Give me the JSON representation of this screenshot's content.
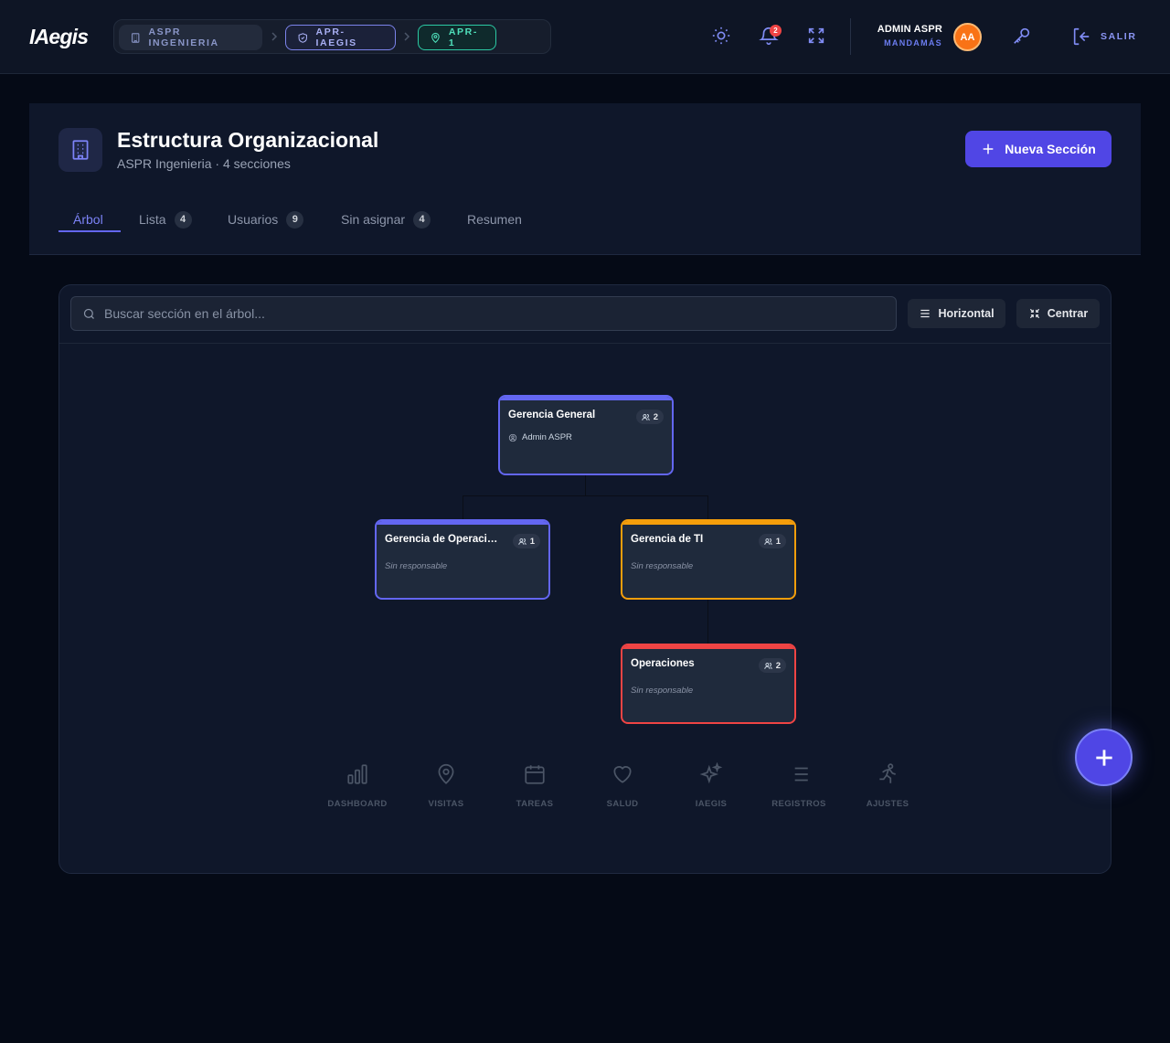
{
  "app": {
    "logo": "IAegis"
  },
  "breadcrumb": {
    "items": [
      {
        "label": "ASPR INGENIERIA",
        "icon": "building-icon"
      },
      {
        "label": "APR-IAEGIS",
        "icon": "shield-icon"
      },
      {
        "label": "APR-1",
        "icon": "map-pin-icon"
      }
    ]
  },
  "topbar": {
    "notifications_count": "2",
    "user_name": "ADMIN ASPR",
    "user_role": "MANDAMÁS",
    "avatar_initials": "AA",
    "logout_label": "SALIR"
  },
  "colors": {
    "accent": "#5046e5",
    "indigo_node": "#6366f1",
    "amber_node": "#f59e0b",
    "red_node": "#ef4444",
    "teal_crumb": "#2cc9a4",
    "avatar": "#f97316"
  },
  "header": {
    "title": "Estructura Organizacional",
    "subtitle": "ASPR Ingenieria · 4 secciones",
    "new_button": "Nueva Sección"
  },
  "tabs": [
    {
      "label": "Árbol",
      "count": "",
      "active": true
    },
    {
      "label": "Lista",
      "count": "4"
    },
    {
      "label": "Usuarios",
      "count": "9"
    },
    {
      "label": "Sin asignar",
      "count": "4"
    },
    {
      "label": "Resumen",
      "count": ""
    }
  ],
  "toolbar": {
    "search_placeholder": "Buscar sección en el árbol...",
    "horizontal_label": "Horizontal",
    "center_label": "Centrar"
  },
  "tree": {
    "nodes": [
      {
        "title": "Gerencia General",
        "count": "2",
        "owner": "Admin ASPR",
        "accent": "indigo"
      },
      {
        "title": "Gerencia de Operaciones",
        "count": "1",
        "owner": "Sin responsable",
        "accent": "indigo"
      },
      {
        "title": "Gerencia de TI",
        "count": "1",
        "owner": "Sin responsable",
        "accent": "amber"
      },
      {
        "title": "Operaciones",
        "count": "2",
        "owner": "Sin responsable",
        "accent": "red"
      }
    ]
  },
  "bottom_nav": [
    {
      "label": "DASHBOARD",
      "icon": "bar-chart-icon"
    },
    {
      "label": "VISITAS",
      "icon": "map-pin-icon"
    },
    {
      "label": "TAREAS",
      "icon": "calendar-icon"
    },
    {
      "label": "SALUD",
      "icon": "heart-icon"
    },
    {
      "label": "IAEGIS",
      "icon": "sparkles-icon"
    },
    {
      "label": "REGISTROS",
      "icon": "list-icon"
    },
    {
      "label": "AJUSTES",
      "icon": "running-person-icon"
    }
  ]
}
